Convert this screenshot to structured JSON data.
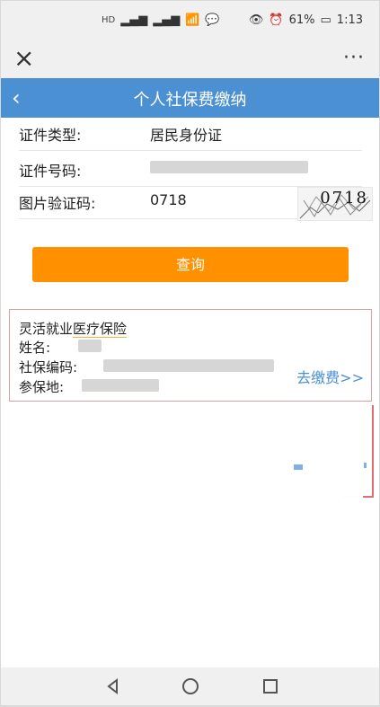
{
  "status": {
    "battery": "61%",
    "time": "1:13"
  },
  "header": {
    "title": "个人社保费缴纳"
  },
  "form": {
    "id_type_label": "证件类型:",
    "id_type_value": "居民身份证",
    "id_number_label": "证件号码:",
    "captcha_label": "图片验证码:",
    "captcha_value": "0718",
    "captcha_image_text": "0718",
    "query_label": "查询"
  },
  "card": {
    "insurance_prefix": "灵活就业",
    "insurance_suffix": "医疗保险",
    "name_label": "姓名:",
    "social_number_label": "社保编码:",
    "location_label": "参保地:",
    "pay_label": "去缴费>>"
  },
  "colors": {
    "header_blue": "#4a90d2",
    "button_orange": "#ff9000",
    "link_blue": "#4a90d2"
  }
}
